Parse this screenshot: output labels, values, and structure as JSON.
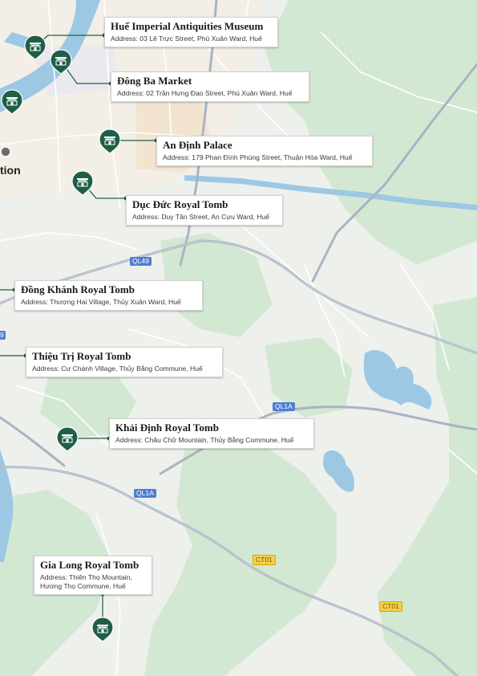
{
  "colors": {
    "pin": "#1f5e47",
    "connector": "#1f5e47",
    "water": "#9cc8e4",
    "forest": "#cfe6cf",
    "road_major": "#a9b3c3",
    "road_minor": "#ffffff"
  },
  "places": [
    {
      "name": "Huế Imperial Antiquities Museum",
      "address": "Address: 03 Lê Trực Street, Phú Xuân Ward, Huế"
    },
    {
      "name": "Đông Ba Market",
      "address": "Address: 02 Trần Hưng Đạo Street, Phú Xuân Ward, Huế"
    },
    {
      "name": "An Định Palace",
      "address": "Address: 179 Phan Đình Phùng Street, Thuận Hóa Ward, Huế"
    },
    {
      "name": "Dục Đức Royal Tomb",
      "address": "Address: Duy Tân Street, An Cựu Ward, Huế"
    },
    {
      "name": "Đồng Khánh Royal Tomb",
      "address": "Address: Thượng Hai Village, Thủy Xuân Ward, Huế"
    },
    {
      "name": "Thiệu Trị Royal Tomb",
      "address": "Address: Cư Chánh Village, Thủy Bằng Commune, Huế"
    },
    {
      "name": "Khải Định Royal Tomb",
      "address": "Address: Châu Chữ Mountain, Thủy Bằng Commune, Huế"
    },
    {
      "name": "Gia Long Royal Tomb",
      "address": "Address: Thiên Thọ Mountain, Hương Thọ Commune, Huế"
    }
  ],
  "road_labels": [
    "QL49",
    "QL1A",
    "QL1A",
    "CT01",
    "CT01",
    "9"
  ],
  "partial_label": "tion",
  "pin_icon": "temple-gate-icon"
}
